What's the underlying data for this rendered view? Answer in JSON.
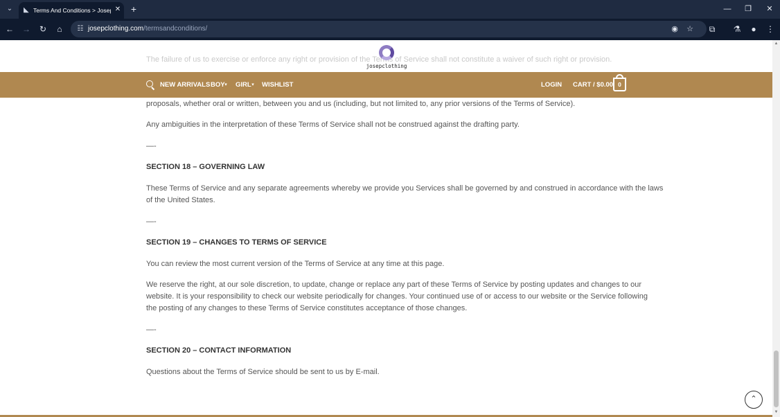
{
  "browser": {
    "tab_menu_icon": "chevron-down-icon",
    "tab_title": "Terms And Conditions > Josep",
    "tab_close": "✕",
    "new_tab": "+",
    "window": {
      "minimize": "—",
      "restore": "❐",
      "close": "✕"
    },
    "url_host": "josepclothing.com",
    "url_path": "/termsandconditions/"
  },
  "page": {
    "faded_text": "The failure of us to exercise or enforce any right or provision of the Terms of Service shall not constitute a waiver of such right or provision.",
    "logo_text": "josepclothing",
    "nav": {
      "new_arrivals": "NEW ARRIVALS",
      "boy": "BOY",
      "girl": "GIRL",
      "wishlist": "WISHLIST",
      "login": "LOGIN",
      "cart": "CART / $0.00",
      "cart_count": "0"
    },
    "lines": {
      "l1": "proposals, whether oral or written, between you and us (including, but not limited to, any prior versions of the Terms of Service).",
      "l2": "Any ambiguities in the interpretation of these Terms of Service shall not be construed against the drafting party.",
      "sep": "—-",
      "s18": "SECTION 18 – GOVERNING LAW",
      "s18_p1a": "These Terms of Service and any separate agreements whereby we provide you Services shall be governed by and construed in accordance with the laws",
      "s18_p1b": "of the United States.",
      "s19": "SECTION 19 – CHANGES TO TERMS OF SERVICE",
      "s19_p1": "You can review the most current version of the Terms of Service at any time at this page.",
      "s19_p2a": "We reserve the right, at our sole discretion, to update, change or replace any part of these Terms of Service by posting updates and changes to our",
      "s19_p2b": "website. It is your responsibility to check our website periodically for changes. Your continued use of or access to our website or the Service following",
      "s19_p2c": "the posting of any changes to these Terms of Service constitutes acceptance of those changes.",
      "s20": "SECTION 20 – CONTACT INFORMATION",
      "s20_p1": "Questions about the Terms of Service should be sent to us by E-mail."
    },
    "colors": {
      "nav_bg": "#b08850",
      "chrome_bg": "#1f2b41",
      "text": "#555555"
    }
  }
}
